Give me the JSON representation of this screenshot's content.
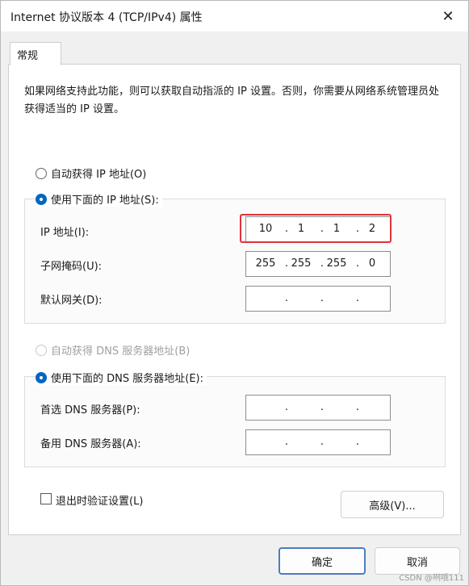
{
  "window": {
    "title": "Internet 协议版本 4 (TCP/IPv4) 属性",
    "close_glyph": "✕"
  },
  "tab": {
    "label": "常规"
  },
  "description": "如果网络支持此功能，则可以获取自动指派的 IP 设置。否则，你需要从网络系统管理员处获得适当的 IP 设置。",
  "ip_section": {
    "auto_label": "自动获得 IP 地址(O)",
    "manual_label": "使用下面的 IP 地址(S):",
    "fields": [
      {
        "label": "IP 地址(I):",
        "octets": [
          "10",
          "1",
          "1",
          "2"
        ]
      },
      {
        "label": "子网掩码(U):",
        "octets": [
          "255",
          "255",
          "255",
          "0"
        ]
      },
      {
        "label": "默认网关(D):",
        "octets": [
          "",
          "",
          "",
          ""
        ]
      }
    ]
  },
  "dns_section": {
    "auto_label": "自动获得 DNS 服务器地址(B)",
    "manual_label": "使用下面的 DNS 服务器地址(E):",
    "fields": [
      {
        "label": "首选 DNS 服务器(P):",
        "octets": [
          "",
          "",
          "",
          ""
        ]
      },
      {
        "label": "备用 DNS 服务器(A):",
        "octets": [
          "",
          "",
          "",
          ""
        ]
      }
    ]
  },
  "validate_label": "退出时验证设置(L)",
  "advanced_label": "高级(V)...",
  "ok_label": "确定",
  "cancel_label": "取消",
  "watermark": "CSDN @咧哦111",
  "colors": {
    "accent": "#0067c0",
    "highlight": "#e0323c"
  },
  "dot_glyph": "."
}
